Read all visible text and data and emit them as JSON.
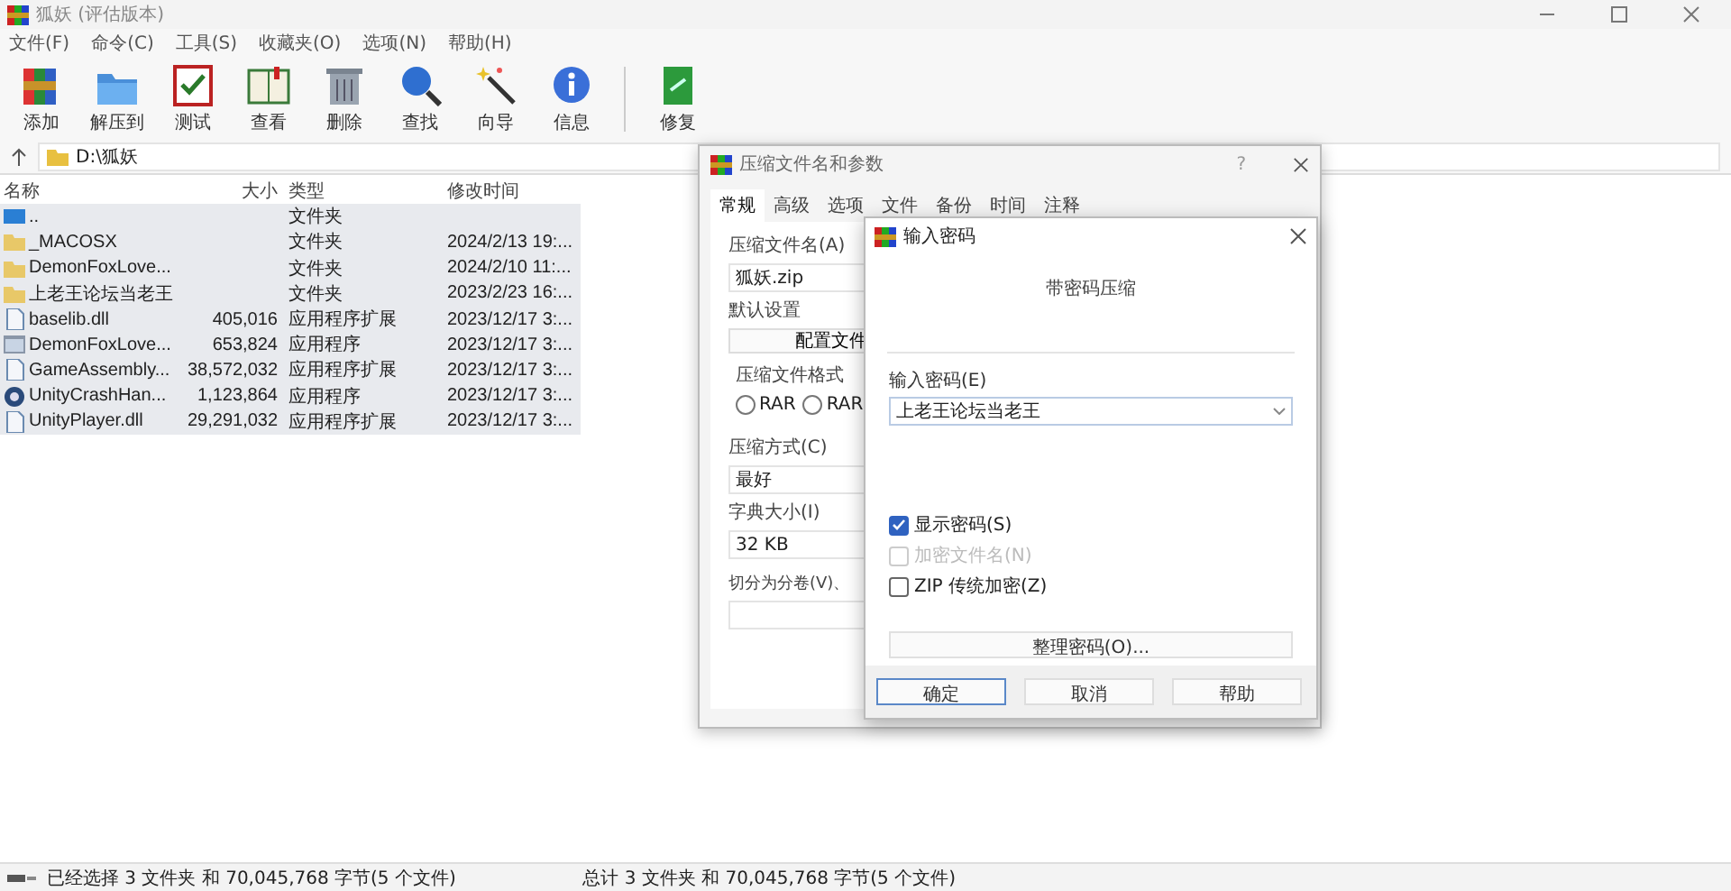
{
  "window": {
    "title": "狐妖 (评估版本)"
  },
  "menu": [
    "文件(F)",
    "命令(C)",
    "工具(S)",
    "收藏夹(O)",
    "选项(N)",
    "帮助(H)"
  ],
  "toolbar": [
    {
      "label": "添加",
      "kind": "books"
    },
    {
      "label": "解压到",
      "kind": "folder"
    },
    {
      "label": "测试",
      "kind": "checklist"
    },
    {
      "label": "查看",
      "kind": "book"
    },
    {
      "label": "删除",
      "kind": "trash"
    },
    {
      "label": "查找",
      "kind": "magnifier"
    },
    {
      "label": "向导",
      "kind": "wand"
    },
    {
      "label": "信息",
      "kind": "info"
    },
    {
      "label": "修复",
      "kind": "repair"
    }
  ],
  "address": {
    "path": "D:\\狐妖"
  },
  "file_list": {
    "columns": [
      "名称",
      "大小",
      "类型",
      "修改时间"
    ],
    "rows": [
      {
        "kind": "parent",
        "name": "..",
        "type": "文件夹",
        "selected": true
      },
      {
        "kind": "folder",
        "name": "_MACOSX",
        "type": "文件夹",
        "modified": "2024/2/13 19:...",
        "selected": true
      },
      {
        "kind": "folder",
        "name": "DemonFoxLove...",
        "type": "文件夹",
        "modified": "2024/2/10 11:...",
        "selected": true
      },
      {
        "kind": "folder",
        "name": "上老王论坛当老王",
        "type": "文件夹",
        "modified": "2023/2/23 16:...",
        "selected": true
      },
      {
        "kind": "dll",
        "name": "baselib.dll",
        "size": "405,016",
        "type": "应用程序扩展",
        "modified": "2023/12/17 3:...",
        "selected": true
      },
      {
        "kind": "exe",
        "name": "DemonFoxLove...",
        "size": "653,824",
        "type": "应用程序",
        "modified": "2023/12/17 3:...",
        "selected": true
      },
      {
        "kind": "dll",
        "name": "GameAssembly...",
        "size": "38,572,032",
        "type": "应用程序扩展",
        "modified": "2023/12/17 3:...",
        "selected": true
      },
      {
        "kind": "unity",
        "name": "UnityCrashHan...",
        "size": "1,123,864",
        "type": "应用程序",
        "modified": "2023/12/17 3:...",
        "selected": true
      },
      {
        "kind": "dll",
        "name": "UnityPlayer.dll",
        "size": "29,291,032",
        "type": "应用程序扩展",
        "modified": "2023/12/17 3:...",
        "selected": true
      }
    ]
  },
  "status_bar": {
    "selection": "已经选择 3 文件夹 和 70,045,768 字节(5 个文件)",
    "total": "总计 3 文件夹 和 70,045,768 字节(5 个文件)"
  },
  "archive_dialog": {
    "title": "压缩文件名和参数",
    "help": "?",
    "tabs": [
      {
        "label": "常规",
        "selected": true
      },
      {
        "label": "高级",
        "selected": false
      },
      {
        "label": "选项",
        "selected": false
      },
      {
        "label": "文件",
        "selected": false
      },
      {
        "label": "备份",
        "selected": false
      },
      {
        "label": "时间",
        "selected": false
      },
      {
        "label": "注释",
        "selected": false
      }
    ],
    "name_label": "压缩文件名(A)",
    "name_value": "狐妖.zip",
    "default_label": "默认设置",
    "profile_button": "配置文件",
    "format_label": "压缩文件格式",
    "formats": [
      {
        "label": "RAR",
        "selected": false
      },
      {
        "label": "RAR",
        "selected": false
      }
    ],
    "method_label": "压缩方式(C)",
    "method_value": "最好",
    "dict_label": "字典大小(I)",
    "dict_value": "32 KB",
    "split_label": "切分为分卷(V)、"
  },
  "password_dialog": {
    "title": "输入密码",
    "heading": "带密码压缩",
    "password_label": "输入密码(E)",
    "password_value": "上老王论坛当老王",
    "options": [
      {
        "label": "显示密码(S)",
        "checked": true,
        "disabled": false
      },
      {
        "label": "加密文件名(N)",
        "checked": false,
        "disabled": true
      },
      {
        "label": "ZIP 传统加密(Z)",
        "checked": false,
        "disabled": false
      }
    ],
    "organize_button": "整理密码(O)...",
    "buttons": [
      {
        "label": "确定",
        "default": true
      },
      {
        "label": "取消",
        "default": false
      },
      {
        "label": "帮助",
        "default": false
      }
    ]
  }
}
